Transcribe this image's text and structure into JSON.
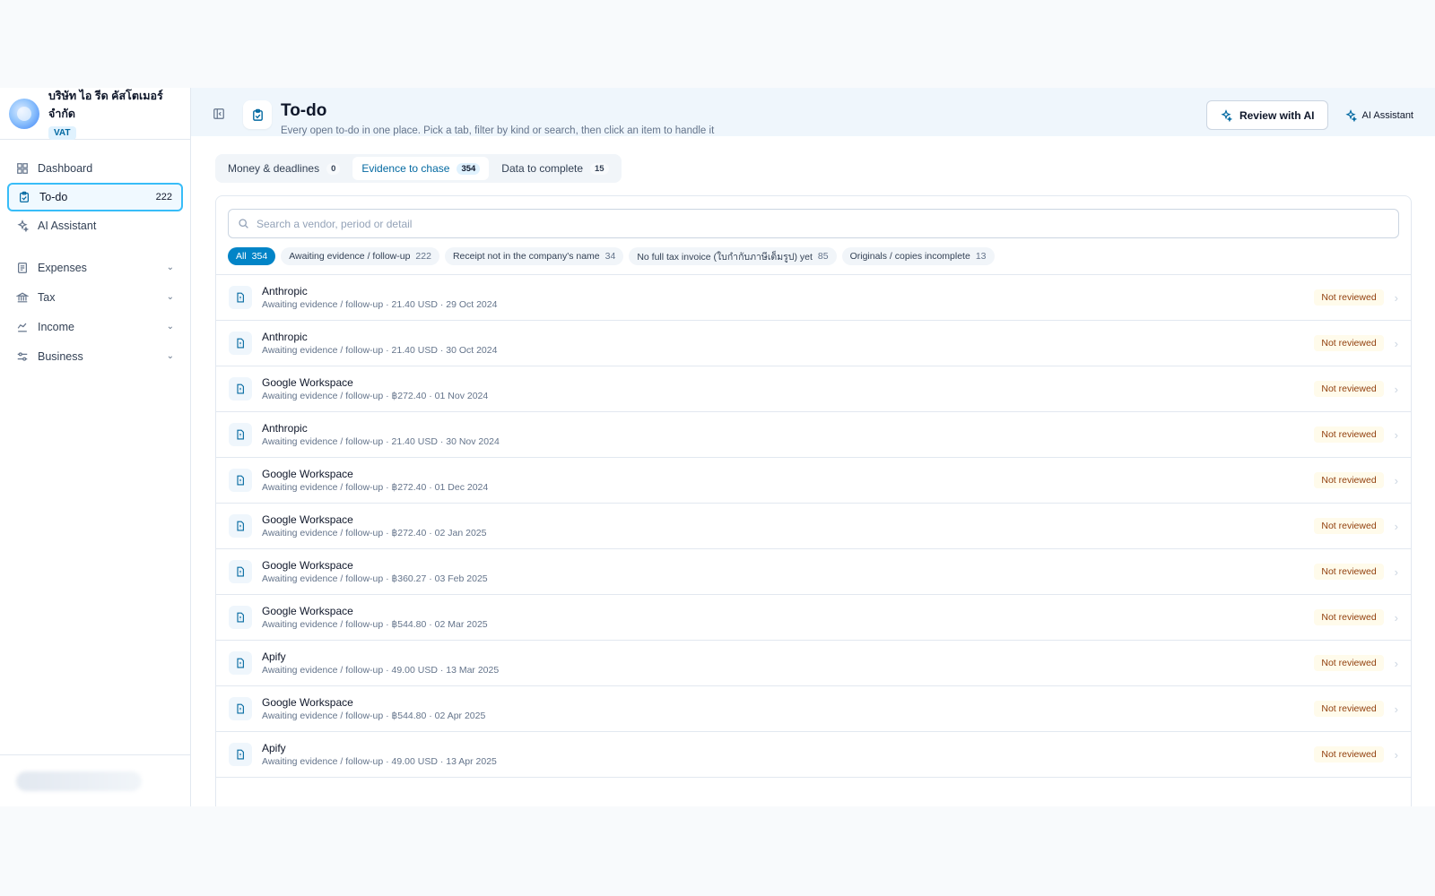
{
  "brand": {
    "name": "บริษัท ไอ รีด คัสโตเมอร์ จำกัด",
    "badge": "VAT"
  },
  "sidebar": {
    "items": [
      {
        "label": "Dashboard",
        "icon": "dashboard-icon"
      },
      {
        "label": "To-do",
        "count": "222",
        "icon": "clipboard-check-icon",
        "active": true
      },
      {
        "label": "AI Assistant",
        "icon": "sparkles-icon"
      }
    ],
    "groups": [
      {
        "label": "Expenses",
        "icon": "receipt-icon"
      },
      {
        "label": "Tax",
        "icon": "bank-icon"
      },
      {
        "label": "Income",
        "icon": "coins-icon"
      },
      {
        "label": "Business",
        "icon": "sliders-icon"
      }
    ]
  },
  "header": {
    "title": "To-do",
    "subtitle": "Every open to-do in one place. Pick a tab, filter by kind or search, then click an item to handle it",
    "review_label": "Review with AI",
    "assistant_label": "AI Assistant"
  },
  "tabs": [
    {
      "label": "Money & deadlines",
      "count": "0"
    },
    {
      "label": "Evidence to chase",
      "count": "354",
      "active": true
    },
    {
      "label": "Data to complete",
      "count": "15"
    }
  ],
  "search": {
    "placeholder": "Search a vendor, period or detail"
  },
  "chips": [
    {
      "label": "All",
      "count": "354",
      "active": true
    },
    {
      "label": "Awaiting evidence / follow-up",
      "count": "222"
    },
    {
      "label": "Receipt not in the company's name",
      "count": "34"
    },
    {
      "label": "No full tax invoice (ใบกำกับภาษีเต็มรูป) yet",
      "count": "85"
    },
    {
      "label": "Originals / copies incomplete",
      "count": "13"
    }
  ],
  "rows": [
    {
      "title": "Anthropic",
      "meta": "Awaiting evidence / follow-up · 21.40 USD · 29 Oct 2024",
      "status": "Not reviewed"
    },
    {
      "title": "Anthropic",
      "meta": "Awaiting evidence / follow-up · 21.40 USD · 30 Oct 2024",
      "status": "Not reviewed"
    },
    {
      "title": "Google Workspace",
      "meta": "Awaiting evidence / follow-up · ฿272.40 · 01 Nov 2024",
      "status": "Not reviewed"
    },
    {
      "title": "Anthropic",
      "meta": "Awaiting evidence / follow-up · 21.40 USD · 30 Nov 2024",
      "status": "Not reviewed"
    },
    {
      "title": "Google Workspace",
      "meta": "Awaiting evidence / follow-up · ฿272.40 · 01 Dec 2024",
      "status": "Not reviewed"
    },
    {
      "title": "Google Workspace",
      "meta": "Awaiting evidence / follow-up · ฿272.40 · 02 Jan 2025",
      "status": "Not reviewed"
    },
    {
      "title": "Google Workspace",
      "meta": "Awaiting evidence / follow-up · ฿360.27 · 03 Feb 2025",
      "status": "Not reviewed"
    },
    {
      "title": "Google Workspace",
      "meta": "Awaiting evidence / follow-up · ฿544.80 · 02 Mar 2025",
      "status": "Not reviewed"
    },
    {
      "title": "Apify",
      "meta": "Awaiting evidence / follow-up · 49.00 USD · 13 Mar 2025",
      "status": "Not reviewed"
    },
    {
      "title": "Google Workspace",
      "meta": "Awaiting evidence / follow-up · ฿544.80 · 02 Apr 2025",
      "status": "Not reviewed"
    },
    {
      "title": "Apify",
      "meta": "Awaiting evidence / follow-up · 49.00 USD · 13 Apr 2025",
      "status": "Not reviewed"
    }
  ],
  "colors": {
    "accent": "#0284c7",
    "header_bg": "#eff6fc",
    "status_text": "#92400e",
    "status_bg": "#fffbeb"
  }
}
